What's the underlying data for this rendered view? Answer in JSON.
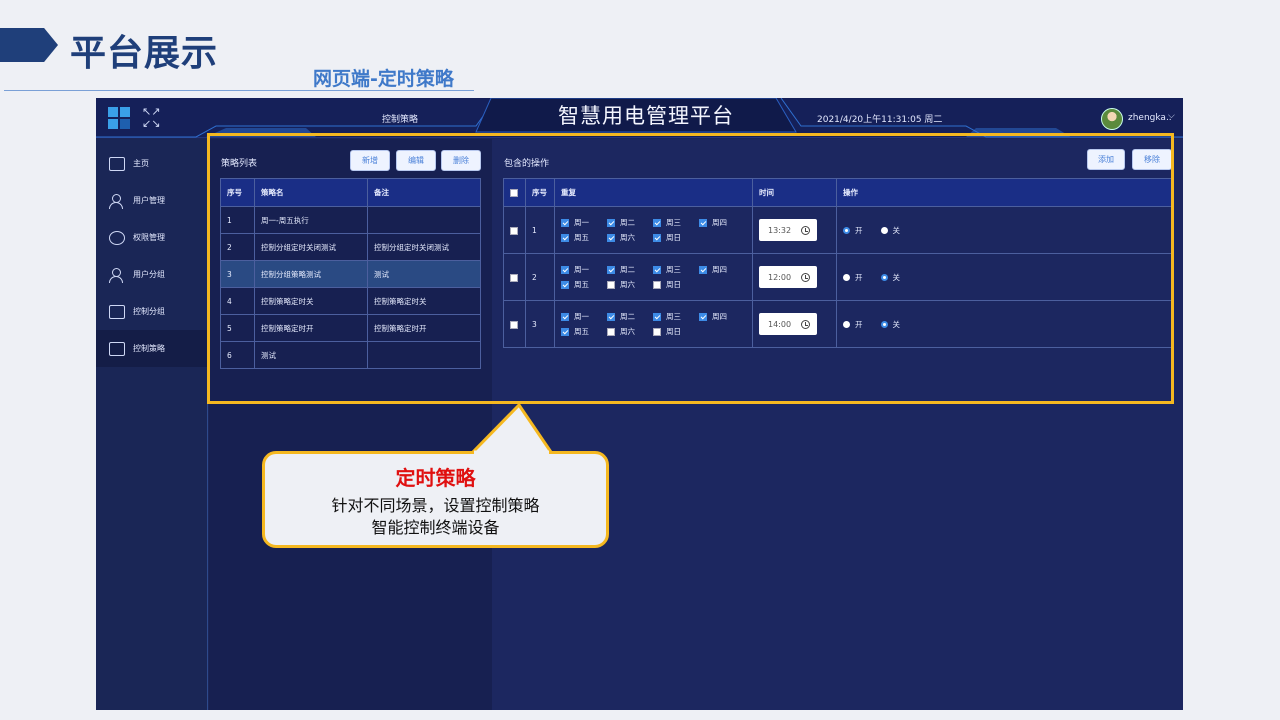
{
  "slide": {
    "title": "平台展示",
    "subtitle": "网页端-定时策略"
  },
  "app": {
    "nav_current": "控制策略",
    "title": "智慧用电管理平台",
    "datetime": "2021/4/20上午11:31:05 周二",
    "username": "zhengka..",
    "colors": {
      "bg": "#1c2658",
      "accent": "#3d8be6",
      "highlight": "#f5b820"
    }
  },
  "sidebar": {
    "items": [
      {
        "label": "主页",
        "icon": "monitor-icon"
      },
      {
        "label": "用户管理",
        "icon": "user-manage-icon"
      },
      {
        "label": "权限管理",
        "icon": "shield-icon"
      },
      {
        "label": "用户分组",
        "icon": "user-group-icon"
      },
      {
        "label": "控制分组",
        "icon": "control-group-icon"
      },
      {
        "label": "控制策略",
        "icon": "control-strategy-icon",
        "active": true
      }
    ]
  },
  "strategy_list": {
    "title": "策略列表",
    "buttons": {
      "add": "新增",
      "edit": "编辑",
      "delete": "删除"
    },
    "columns": [
      "序号",
      "策略名",
      "备注"
    ],
    "rows": [
      [
        "1",
        "周一-周五执行",
        ""
      ],
      [
        "2",
        "控制分组定时关闭测试",
        "控制分组定时关闭测试"
      ],
      [
        "3",
        "控制分组策略测试",
        "测试"
      ],
      [
        "4",
        "控制策略定时关",
        "控制策略定时关"
      ],
      [
        "5",
        "控制策略定时开",
        "控制策略定时开"
      ],
      [
        "6",
        "测试",
        ""
      ]
    ],
    "selected_row": 3
  },
  "operations": {
    "title": "包含的操作",
    "buttons": {
      "add": "添加",
      "remove": "移除"
    },
    "columns": {
      "index": "序号",
      "repeat": "重复",
      "time": "时间",
      "action": "操作"
    },
    "days": [
      "周一",
      "周二",
      "周三",
      "周四",
      "周五",
      "周六",
      "周日"
    ],
    "radio_on": "开",
    "radio_off": "关",
    "rows": [
      {
        "index": "1",
        "days": [
          true,
          true,
          true,
          true,
          true,
          true,
          true
        ],
        "time": "13:32",
        "action": "开"
      },
      {
        "index": "2",
        "days": [
          true,
          true,
          true,
          true,
          true,
          false,
          false
        ],
        "time": "12:00",
        "action": "关"
      },
      {
        "index": "3",
        "days": [
          true,
          true,
          true,
          true,
          true,
          false,
          false
        ],
        "time": "14:00",
        "action": "关"
      }
    ]
  },
  "callout": {
    "title": "定时策略",
    "line1": "针对不同场景，设置控制策略",
    "line2": "智能控制终端设备"
  }
}
